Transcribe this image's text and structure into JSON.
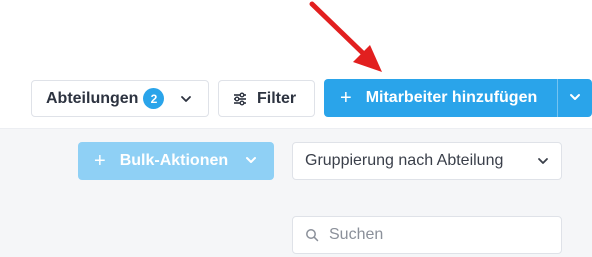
{
  "toolbar": {
    "departments_label": "Abteilungen",
    "departments_count": "2",
    "filter_label": "Filter",
    "add_employee_label": "Mitarbeiter hinzufügen",
    "add_employee_plus": "+"
  },
  "actions": {
    "bulk_label": "Bulk-Aktionen",
    "bulk_plus": "+",
    "grouping_value": "Gruppierung nach Abteilung"
  },
  "search": {
    "placeholder": "Suchen"
  },
  "colors": {
    "accent": "#2aa4ea",
    "accent_light": "#8fd0f5",
    "annotation_arrow": "#e21f1f",
    "panel_bg": "#f5f6f8"
  },
  "icons": {
    "filter": "sliders-icon",
    "chevron": "chevron-down-icon",
    "search": "search-icon",
    "annotation": "red-arrow-icon"
  }
}
